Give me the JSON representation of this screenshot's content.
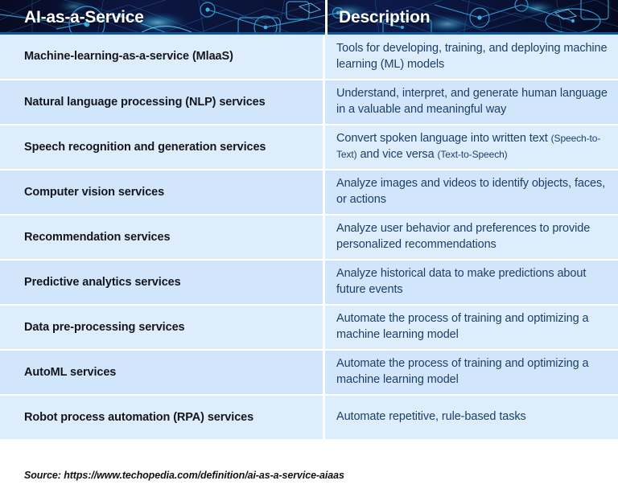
{
  "header": {
    "col_service": "AI-as-a-Service",
    "col_description": "Description"
  },
  "colors": {
    "header_background": "#0a1030",
    "header_accent": "#2ea6e0",
    "row_odd": "#ddedfc",
    "row_even": "#d2e6fb",
    "service_text": "#14161c",
    "description_text": "#1d3f66",
    "divider": "#ffffff"
  },
  "rows": [
    {
      "service": "Machine-learning-as-a-service (MlaaS)",
      "description": "Tools for developing, training, and deploying machine learning (ML) models"
    },
    {
      "service": "Natural language processing (NLP) services",
      "description": "Understand, interpret, and generate human language in a valuable and meaningful way"
    },
    {
      "service": "Speech recognition and generation services",
      "description_parts": [
        {
          "text": "Convert spoken language into written text ",
          "small": false
        },
        {
          "text": "(Speech-to-Text)",
          "small": true
        },
        {
          "text": " and vice versa ",
          "small": false
        },
        {
          "text": "(Text-to-Speech)",
          "small": true
        }
      ],
      "description": "Convert spoken language into written text (Speech-to-Text) and vice versa (Text-to-Speech)"
    },
    {
      "service": "Computer vision services",
      "description": "Analyze images and videos to identify objects, faces, or actions"
    },
    {
      "service": "Recommendation services",
      "description": "Analyze user behavior and preferences to provide personalized recommendations"
    },
    {
      "service": "Predictive analytics services",
      "description": "Analyze historical data to make predictions about future events"
    },
    {
      "service": "Data pre-processing services",
      "description": "Automate the process of training and optimizing a machine learning model"
    },
    {
      "service": "AutoML services",
      "description": "Automate the process of training and optimizing a machine learning model"
    },
    {
      "service": "Robot process automation (RPA) services",
      "description": "Automate repetitive, rule-based tasks"
    }
  ],
  "footer": {
    "source": "Source: https://www.techopedia.com/definition/ai-as-a-service-aiaas"
  }
}
